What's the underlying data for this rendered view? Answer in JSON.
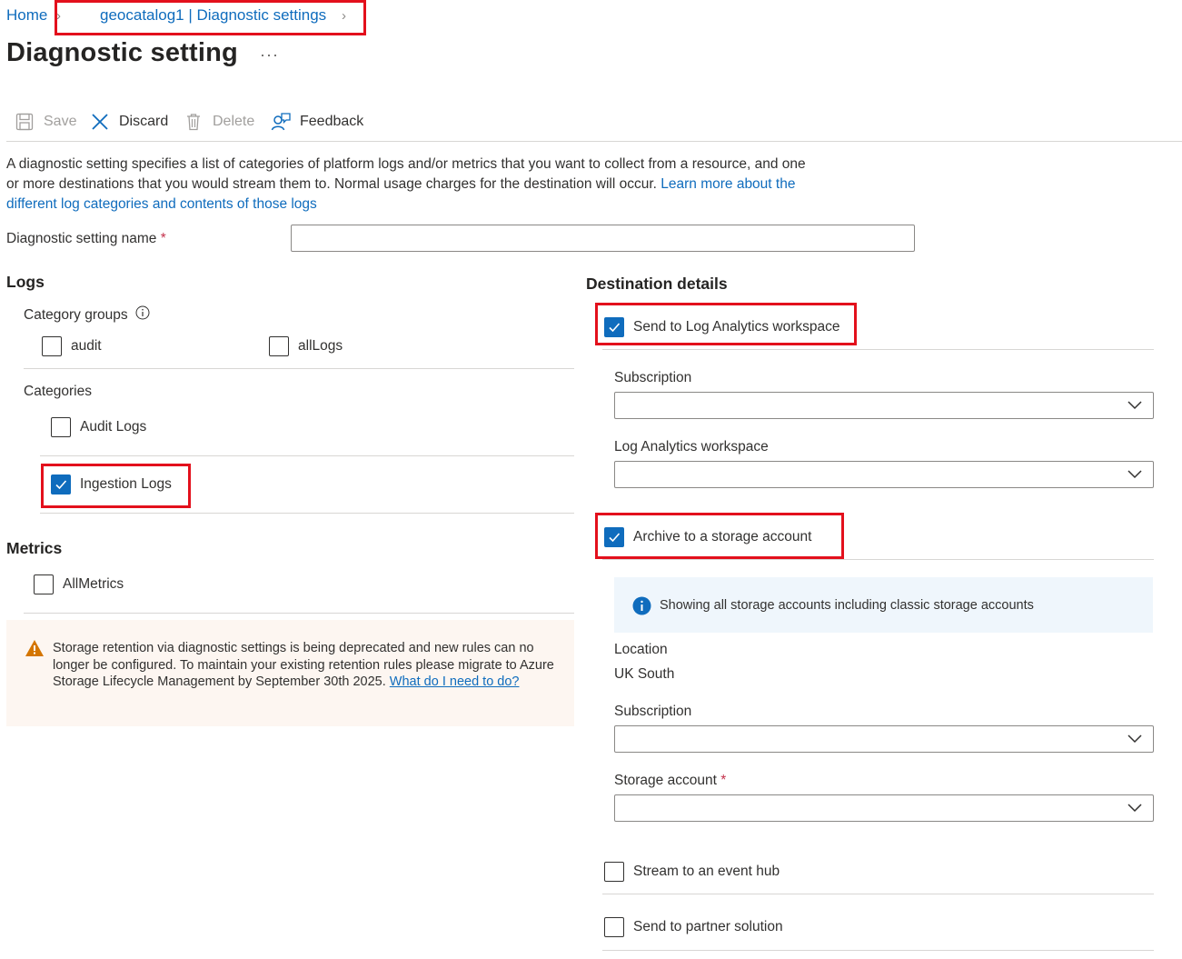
{
  "breadcrumb": {
    "home": "Home",
    "current": "geocatalog1 | Diagnostic settings"
  },
  "page": {
    "title": "Diagnostic setting",
    "more": "···"
  },
  "toolbar": {
    "save": "Save",
    "discard": "Discard",
    "delete": "Delete",
    "feedback": "Feedback"
  },
  "description": {
    "text": "A diagnostic setting specifies a list of categories of platform logs and/or metrics that you want to collect from a resource, and one or more destinations that you would stream them to. Normal usage charges for the destination will occur. ",
    "link": "Learn more about the different log categories and contents of those logs"
  },
  "name_field": {
    "label": "Diagnostic setting name",
    "required": "*",
    "value": ""
  },
  "logs": {
    "heading": "Logs",
    "category_groups_label": "Category groups",
    "groups": [
      {
        "label": "audit",
        "checked": false
      },
      {
        "label": "allLogs",
        "checked": false
      }
    ],
    "categories_label": "Categories",
    "categories": [
      {
        "label": "Audit Logs",
        "checked": false
      },
      {
        "label": "Ingestion Logs",
        "checked": true
      }
    ]
  },
  "metrics": {
    "heading": "Metrics",
    "items": [
      {
        "label": "AllMetrics",
        "checked": false
      }
    ]
  },
  "warning": {
    "text": "Storage retention via diagnostic settings is being deprecated and new rules can no longer be configured. To maintain your existing retention rules please migrate to Azure Storage Lifecycle Management by September 30th 2025. ",
    "link": "What do I need to do?"
  },
  "destination": {
    "heading": "Destination details",
    "log_analytics": {
      "label": "Send to Log Analytics workspace",
      "checked": true,
      "subscription_label": "Subscription",
      "subscription_value": "",
      "workspace_label": "Log Analytics workspace",
      "workspace_value": ""
    },
    "storage": {
      "label": "Archive to a storage account",
      "checked": true,
      "info": "Showing all storage accounts including classic storage accounts",
      "location_label": "Location",
      "location_value": "UK South",
      "subscription_label": "Subscription",
      "subscription_value": "",
      "account_label": "Storage account",
      "account_required": "*",
      "account_value": ""
    },
    "event_hub": {
      "label": "Stream to an event hub",
      "checked": false
    },
    "partner": {
      "label": "Send to partner solution",
      "checked": false
    }
  },
  "colors": {
    "accent": "#0f6cbd",
    "highlight": "#e3101c",
    "warning_bg": "#fdf6f1",
    "info_bg": "#eff6fc"
  }
}
